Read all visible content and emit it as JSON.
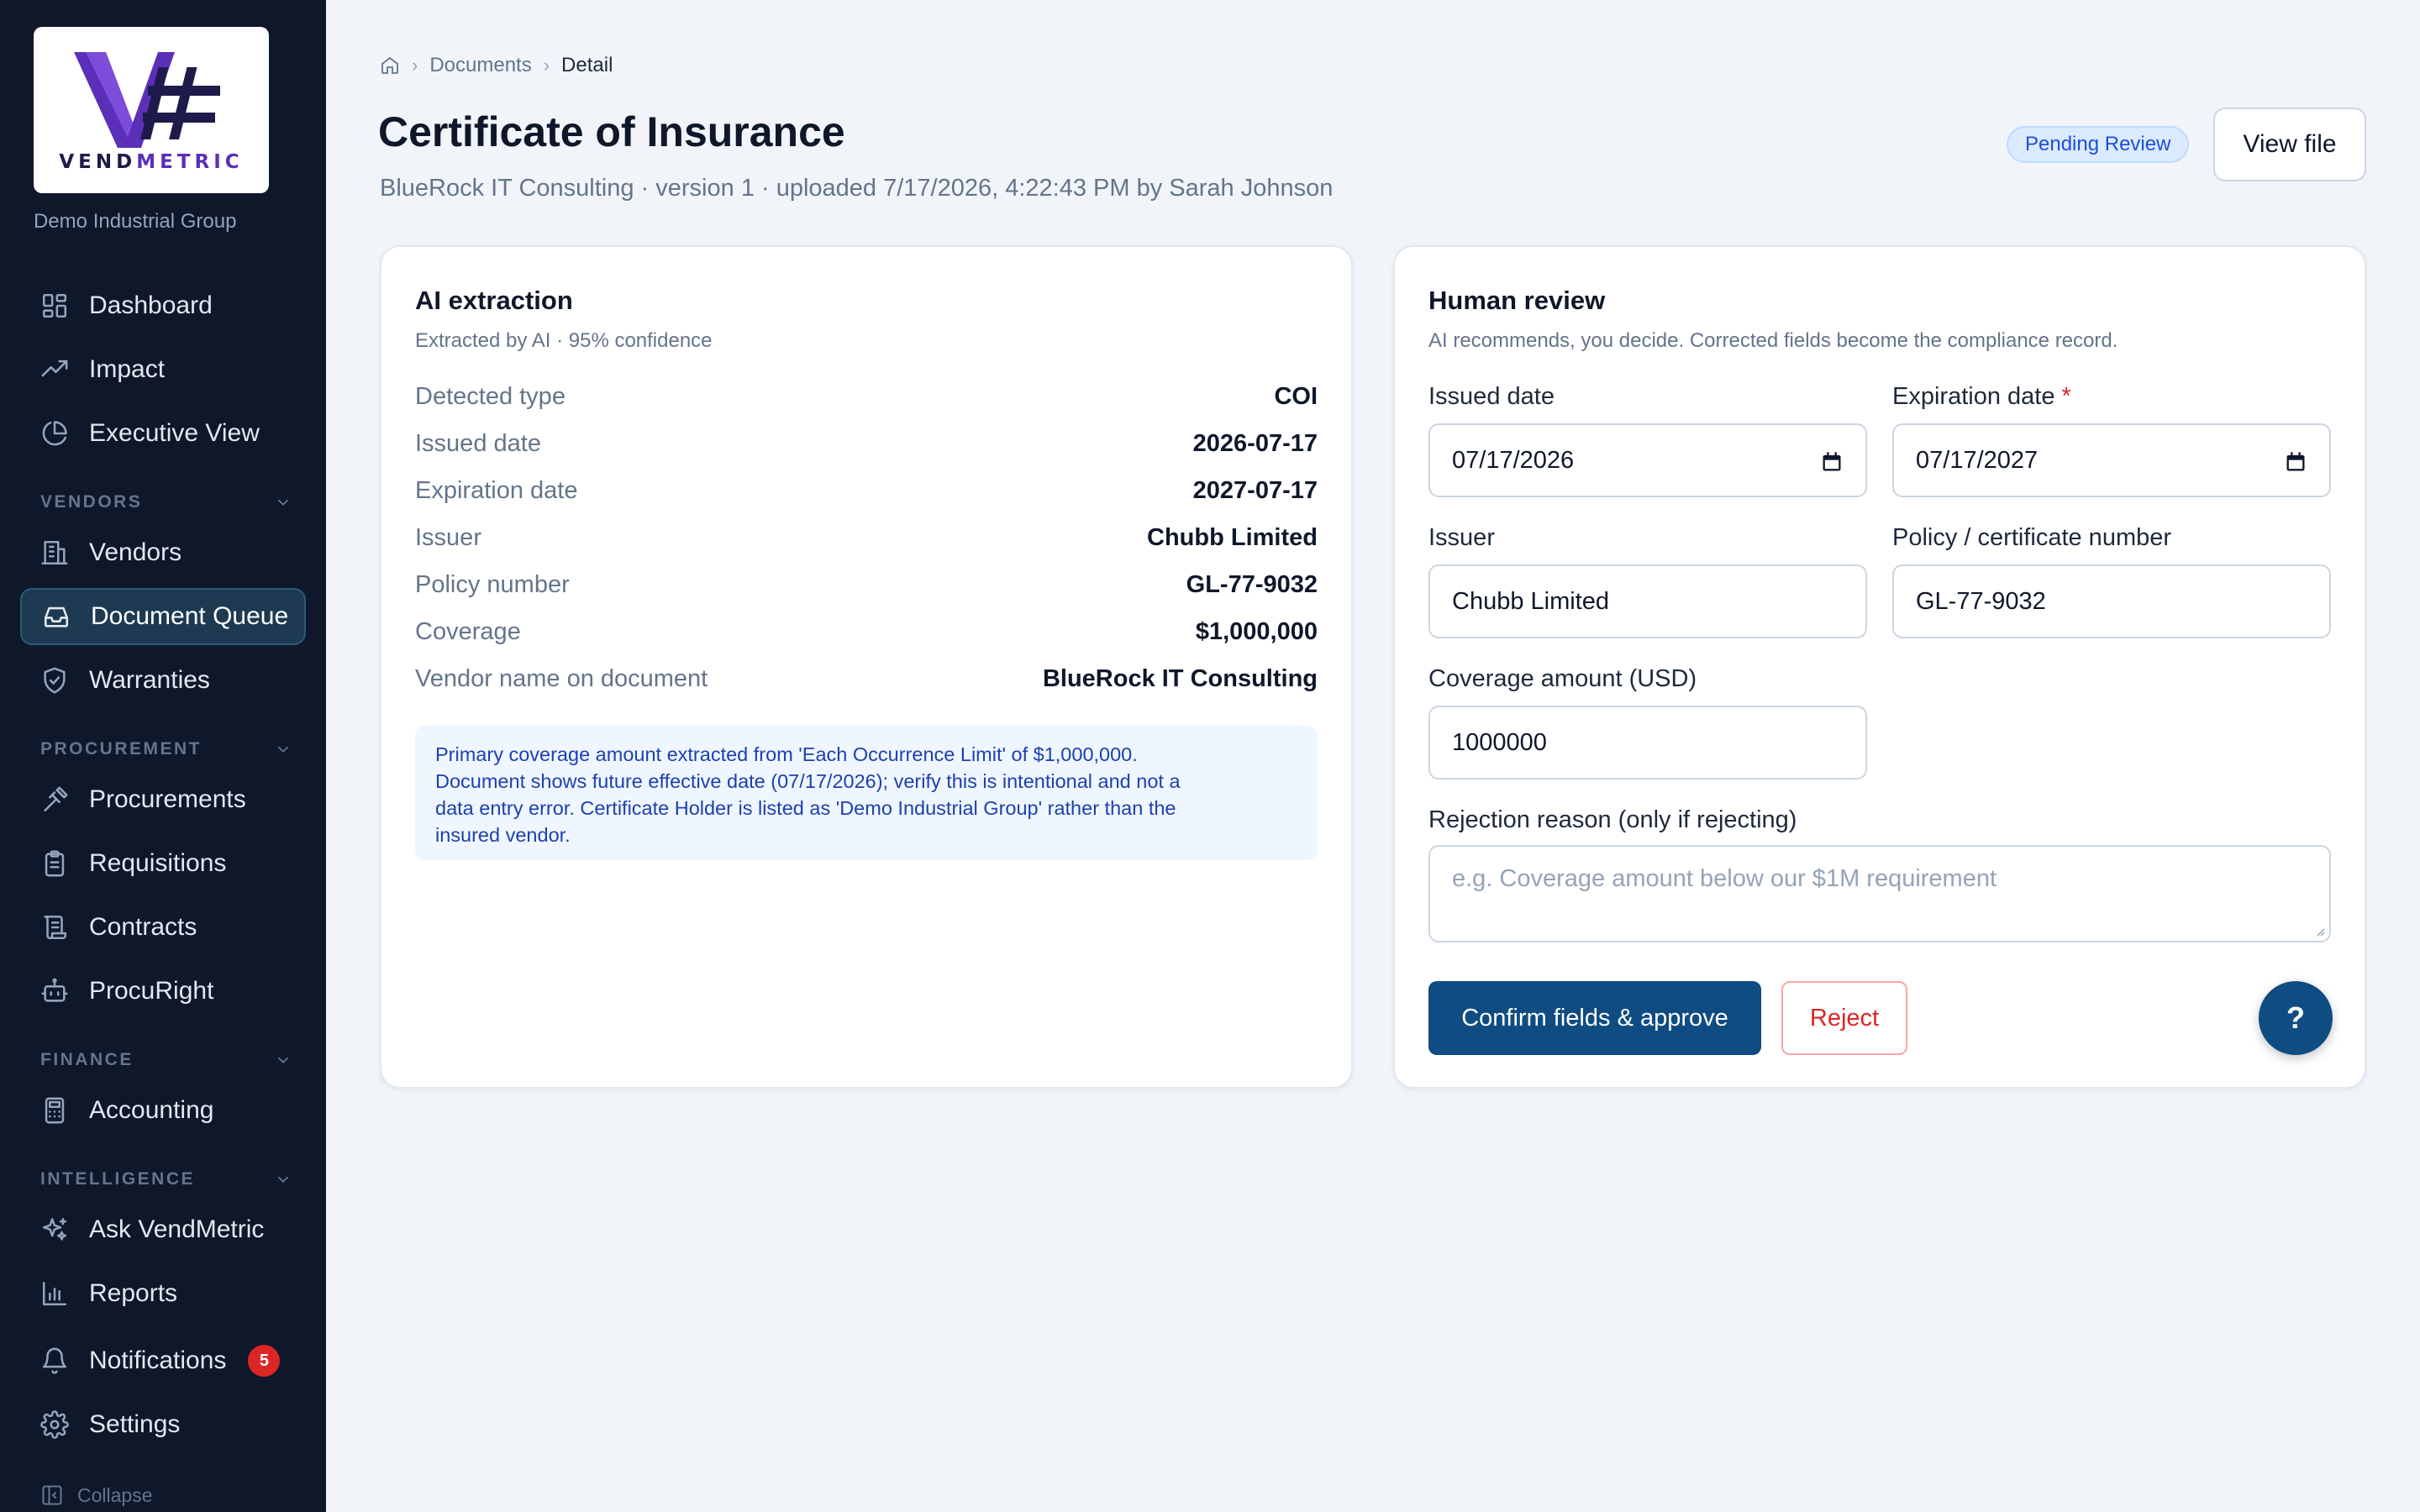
{
  "sidebar": {
    "brand_prefix": "VEND",
    "brand_suffix": "METRIC",
    "org": "Demo Industrial Group",
    "items": [
      {
        "label": "Dashboard",
        "icon": "dashboard-icon"
      },
      {
        "label": "Impact",
        "icon": "trending-up-icon"
      },
      {
        "label": "Executive View",
        "icon": "pie-chart-icon"
      },
      {
        "label": "Vendors",
        "icon": "building-icon"
      },
      {
        "label": "Document Queue",
        "icon": "inbox-icon"
      },
      {
        "label": "Warranties",
        "icon": "shield-check-icon"
      },
      {
        "label": "Procurements",
        "icon": "gavel-icon"
      },
      {
        "label": "Requisitions",
        "icon": "clipboard-icon"
      },
      {
        "label": "Contracts",
        "icon": "scroll-icon"
      },
      {
        "label": "ProcuRight",
        "icon": "bot-icon"
      },
      {
        "label": "Accounting",
        "icon": "calculator-icon"
      },
      {
        "label": "Ask VendMetric",
        "icon": "sparkles-icon"
      },
      {
        "label": "Reports",
        "icon": "bar-chart-icon"
      },
      {
        "label": "Notifications",
        "icon": "bell-icon",
        "badge": "5"
      },
      {
        "label": "Settings",
        "icon": "gear-icon"
      }
    ],
    "sections": {
      "vendors": "VENDORS",
      "procurement": "PROCUREMENT",
      "finance": "FINANCE",
      "intelligence": "INTELLIGENCE"
    },
    "collapse_label": "Collapse"
  },
  "breadcrumb": {
    "documents": "Documents",
    "current": "Detail"
  },
  "header": {
    "title": "Certificate of Insurance",
    "subtitle": "BlueRock IT Consulting · version 1 · uploaded 7/17/2026, 4:22:43 PM by Sarah Johnson",
    "status": "Pending Review",
    "view_file": "View file"
  },
  "extraction": {
    "title": "AI extraction",
    "subtitle": "Extracted by AI · 95% confidence",
    "rows": [
      {
        "label": "Detected type",
        "value": "COI"
      },
      {
        "label": "Issued date",
        "value": "2026-07-17"
      },
      {
        "label": "Expiration date",
        "value": "2027-07-17"
      },
      {
        "label": "Issuer",
        "value": "Chubb Limited"
      },
      {
        "label": "Policy number",
        "value": "GL-77-9032"
      },
      {
        "label": "Coverage",
        "value": "$1,000,000"
      },
      {
        "label": "Vendor name on document",
        "value": "BlueRock IT Consulting"
      }
    ],
    "note_lines": [
      "Primary coverage amount extracted from 'Each Occurrence Limit' of $1,000,000.",
      "Document shows future effective date (07/17/2026); verify this is intentional and not a",
      "data entry error. Certificate Holder is listed as 'Demo Industrial Group' rather than the",
      "insured vendor."
    ]
  },
  "review": {
    "title": "Human review",
    "subtitle": "AI recommends, you decide. Corrected fields become the compliance record.",
    "issued_label": "Issued date",
    "issued_value": "07/17/2026",
    "expiration_label": "Expiration date",
    "required_mark": "*",
    "expiration_value": "07/17/2027",
    "issuer_label": "Issuer",
    "issuer_value": "Chubb Limited",
    "policy_label": "Policy / certificate number",
    "policy_value": "GL-77-9032",
    "coverage_label": "Coverage amount (USD)",
    "coverage_value": "1000000",
    "rejection_label": "Rejection reason (only if rejecting)",
    "rejection_placeholder": "e.g. Coverage amount below our $1M requirement",
    "approve_label": "Confirm fields & approve",
    "reject_label": "Reject"
  },
  "help": {
    "label": "?"
  },
  "colors": {
    "sidebar_bg": "#0f172a",
    "primary": "#0f4c81",
    "danger": "#dc2626",
    "badge_bg": "#dbeafe",
    "note_bg": "#eff6ff"
  }
}
